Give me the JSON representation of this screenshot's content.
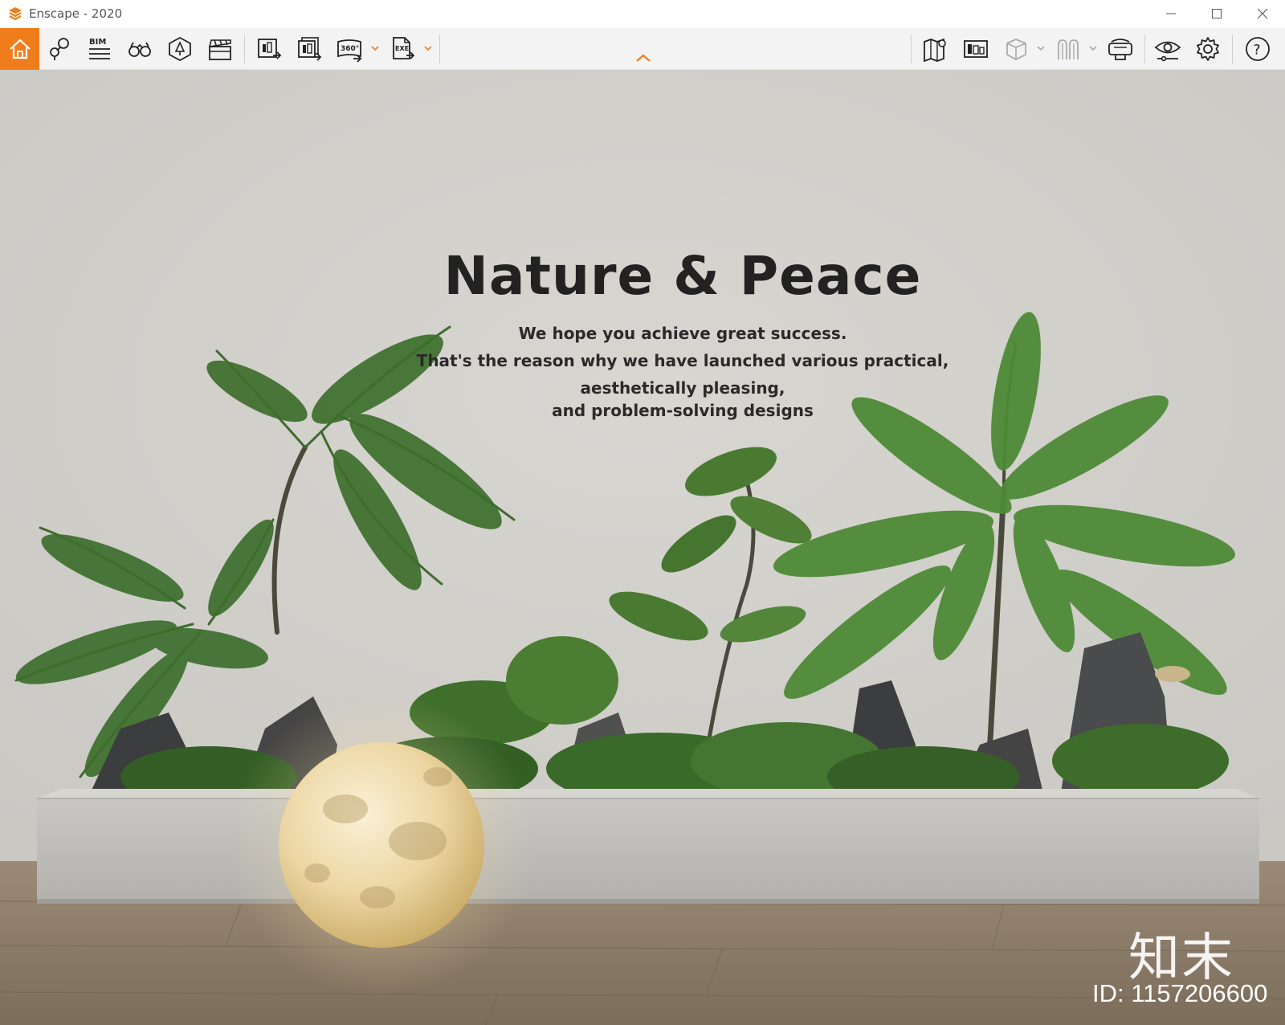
{
  "window": {
    "title": "Enscape - 2020"
  },
  "colors": {
    "accent": "#f07d1c",
    "toolbar_bg": "#f3f3f3",
    "wall": "#d3d1cc",
    "floor": "#8a7a66"
  },
  "toolbar": {
    "left_icons": [
      "home-icon",
      "location-pins-icon",
      "bim-icon",
      "binoculars-icon",
      "asset-library-icon",
      "clapperboard-icon"
    ],
    "bim_label": "BIM",
    "export_icons": [
      "render-screenshot-icon",
      "batch-render-icon",
      "panorama-360-icon",
      "exe-export-icon"
    ],
    "pano_label": "360°",
    "exe_label": "EXE",
    "right_icons": [
      "map-icon",
      "views-icon",
      "cube-icon",
      "pillars-icon",
      "vr-headset-icon",
      "visual-settings-icon",
      "gear-icon",
      "help-icon"
    ],
    "help_label": "?"
  },
  "scene": {
    "title": "Nature & Peace",
    "lines": [
      "We hope you achieve great success.",
      "That's the reason why we have launched various practical,",
      "aesthetically pleasing,",
      "and problem-solving designs"
    ],
    "watermark_logo": "知末",
    "watermark_id": "ID: 1157206600"
  }
}
